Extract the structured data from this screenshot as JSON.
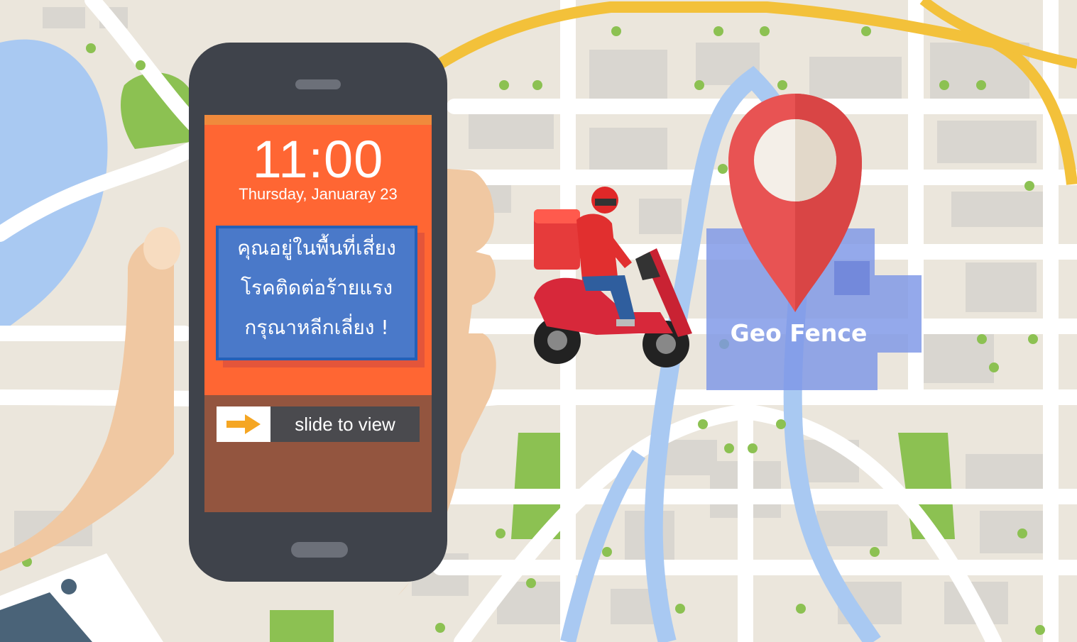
{
  "phone": {
    "time": "11:00",
    "date": "Thursday, Januaray 23",
    "alert_lines": [
      "คุณอยู่ในพื้นที่เสี่ยง",
      "โรคติดต่อร้ายแรง",
      "กรุณาหลีกเลี่ยง !"
    ],
    "slide_label": "slide to view",
    "slide_icon": "arrow-right-icon"
  },
  "map": {
    "geofence_label": "Geo Fence",
    "pin_icon": "location-pin-icon",
    "rider_icon": "delivery-scooter-icon"
  },
  "colors": {
    "map_background": "#ebe6dc",
    "road": "#ffffff",
    "river": "#a9c9f2",
    "park": "#8cc152",
    "major_road": "#f3c13a",
    "phone_body": "#3f434b",
    "screen_orange": "#ff6633",
    "alert_blue": "#4a79c9",
    "pin_red": "#e85353",
    "geofence_blue": "#7d96e6",
    "skin": "#f0c8a2"
  }
}
